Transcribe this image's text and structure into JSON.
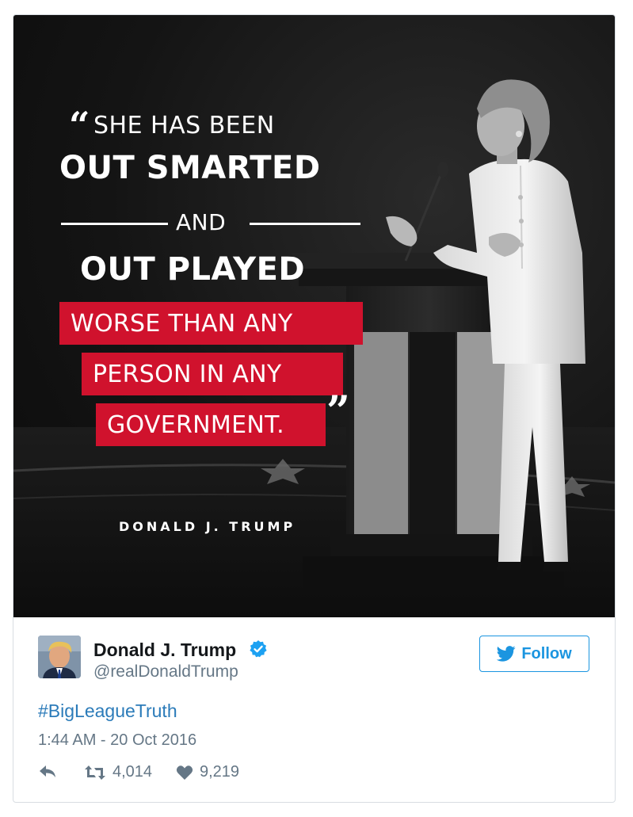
{
  "image": {
    "quote_open": "“",
    "line1": "SHE HAS BEEN",
    "line2": "OUT SMARTED",
    "line3": "AND",
    "line4": "OUT PLAYED",
    "line5": "WORSE THAN ANY",
    "line6": "PERSON IN ANY",
    "line7": "GOVERNMENT.",
    "quote_close": "”",
    "attribution": "DONALD J. TRUMP",
    "accent_color": "#d0122d"
  },
  "author": {
    "name": "Donald J. Trump",
    "handle": "@realDonaldTrump",
    "verified_icon": "verified-badge-icon"
  },
  "follow": {
    "label": "Follow",
    "color": "#1b95e0"
  },
  "tweet": {
    "hashtag": "#BigLeagueTruth",
    "timestamp": "1:44 AM - 20 Oct 2016"
  },
  "actions": {
    "reply_icon": "reply-icon",
    "retweet_icon": "retweet-icon",
    "retweets": "4,014",
    "like_icon": "heart-icon",
    "likes": "9,219"
  }
}
